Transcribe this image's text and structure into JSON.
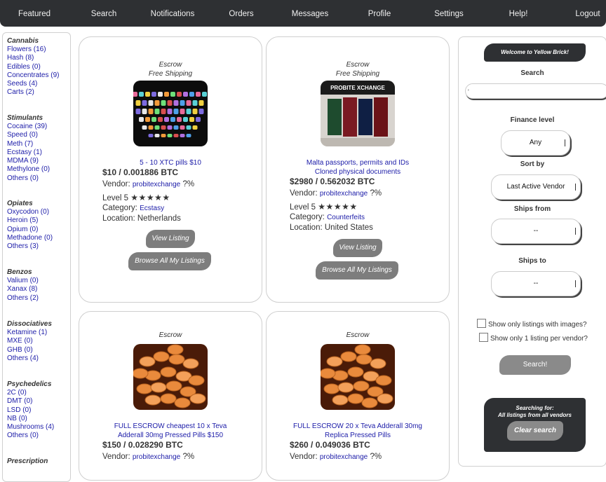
{
  "nav": [
    "Featured",
    "Search",
    "Notifications",
    "Orders",
    "Messages",
    "Profile",
    "Settings",
    "Help!",
    "Logout"
  ],
  "sidebar": {
    "groups": [
      {
        "title": "Cannabis",
        "items": [
          "Flowers (16)",
          "Hash (8)",
          "Edibles (0)",
          "Concentrates (9)",
          "Seeds (4)",
          "Carts (2)"
        ]
      },
      {
        "title": "Stimulants",
        "items": [
          "Cocaine (39)",
          "Speed (0)",
          "Meth (7)",
          "Ecstasy (1)",
          "MDMA (9)",
          "Methylone (0)",
          "Others (0)"
        ]
      },
      {
        "title": "Opiates",
        "items": [
          "Oxycodon (0)",
          "Heroin (5)",
          "Opium (0)",
          "Methadone (0)",
          "Others (3)"
        ]
      },
      {
        "title": "Benzos",
        "items": [
          "Valium (0)",
          "Xanax (8)",
          "Others (2)"
        ]
      },
      {
        "title": "Dissociatives",
        "items": [
          "Ketamine (1)",
          "MXE (0)",
          "GHB (0)",
          "Others (4)"
        ]
      },
      {
        "title": "Psychedelics",
        "items": [
          "2C (0)",
          "DMT (0)",
          "LSD (0)",
          "NB (0)",
          "Mushrooms (4)",
          "Others (0)"
        ]
      },
      {
        "title": "Prescription",
        "items": []
      }
    ]
  },
  "listings": [
    {
      "escrow": "Escrow",
      "shipping": "Free Shipping",
      "title_lines": [
        "5 - 10 XTC pills $10"
      ],
      "price": "$10 / 0.001886 BTC",
      "vendor_label": "Vendor:",
      "vendor": "probitexchange",
      "vendor_rating": "?%",
      "level": "Level 5",
      "stars": "★★★★★",
      "category_label": "Category:",
      "category": "Ecstasy",
      "location": "Location: Netherlands",
      "view_btn": "View Listing",
      "browse_btn": "Browse All My Listings"
    },
    {
      "escrow": "Escrow",
      "shipping": "Free Shipping",
      "title_lines": [
        "Malta passports, permits and IDs",
        "Cloned physical documents"
      ],
      "price": "$2980 / 0.562032 BTC",
      "vendor_label": "Vendor:",
      "vendor": "probitexchange",
      "vendor_rating": "?%",
      "level": "Level 5",
      "stars": "★★★★★",
      "category_label": "Category:",
      "category": "Counterfeits",
      "location": "Location: United States",
      "view_btn": "View Listing",
      "browse_btn": "Browse All My Listings",
      "image_text": "PROBITE XCHANGE"
    },
    {
      "escrow": "Escrow",
      "title_lines": [
        "FULL ESCROW cheapest 10 x Teva",
        "Adderall 30mg Pressed Pills $150"
      ],
      "price": "$150 / 0.028290 BTC",
      "vendor_label": "Vendor:",
      "vendor": "probitexchange",
      "vendor_rating": "?%"
    },
    {
      "escrow": "Escrow",
      "title_lines": [
        "FULL ESCROW 20 x Teva Adderall 30mg",
        "Replica Pressed Pills"
      ],
      "price": "$260 / 0.049036 BTC",
      "vendor_label": "Vendor:",
      "vendor": "probitexchange",
      "vendor_rating": "?%"
    }
  ],
  "right": {
    "welcome": "Welcome to Yellow Brick!",
    "search_label": "Search",
    "search_value": "",
    "finance_label": "Finance level",
    "finance_value": "Any",
    "sort_label": "Sort by",
    "sort_value": "Last Active Vendor",
    "ships_from_label": "Ships from",
    "ships_from_value": "--",
    "ships_to_label": "Ships to",
    "ships_to_value": "--",
    "check_images": "Show only listings with images?",
    "check_vendor": "Show only 1 listing per vendor?",
    "search_btn": "Search!",
    "searching_for": "Searching for:",
    "searching_desc": "All listings from all vendors",
    "clear_btn": "Clear search"
  },
  "colors": {
    "nav_bg": "#2e3033",
    "link": "#1c1ca8",
    "button": "#7d7d7d"
  }
}
